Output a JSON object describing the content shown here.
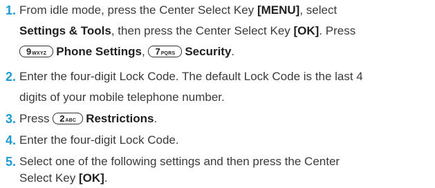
{
  "steps": [
    {
      "number": "1.",
      "line1": {
        "t1": "From idle mode, press the Center Select Key ",
        "b1": "[MENU]",
        "t2": ", select"
      },
      "line2": {
        "b1": "Settings & Tools",
        "t1": ", then press the Center Select Key ",
        "b2": "[OK]",
        "t2": ". Press"
      },
      "line3": {
        "key1_main": "9",
        "key1_sub": "WXYZ",
        "b1": "Phone Settings",
        "t1": ", ",
        "key2_main": "7",
        "key2_sub": "PQRS",
        "b2": "Security",
        "t2": "."
      }
    },
    {
      "number": "2.",
      "line1": "Enter the four-digit Lock Code. The default Lock Code is the last 4",
      "line2": "digits of your mobile telephone number."
    },
    {
      "number": "3.",
      "t1": "Press ",
      "key_main": "2",
      "key_sub": "ABC",
      "b1": "Restrictions",
      "t2": "."
    },
    {
      "number": "4.",
      "line1": "Enter the four-digit Lock Code."
    },
    {
      "number": "5.",
      "line1": "Select one of the following settings and then press the Center",
      "line2": {
        "t1": "Select Key ",
        "b1": "[OK]",
        "t2": "."
      }
    }
  ],
  "colors": {
    "number": "#1a9bd7",
    "text": "#3a3a3a",
    "bold": "#1f1f1f"
  }
}
